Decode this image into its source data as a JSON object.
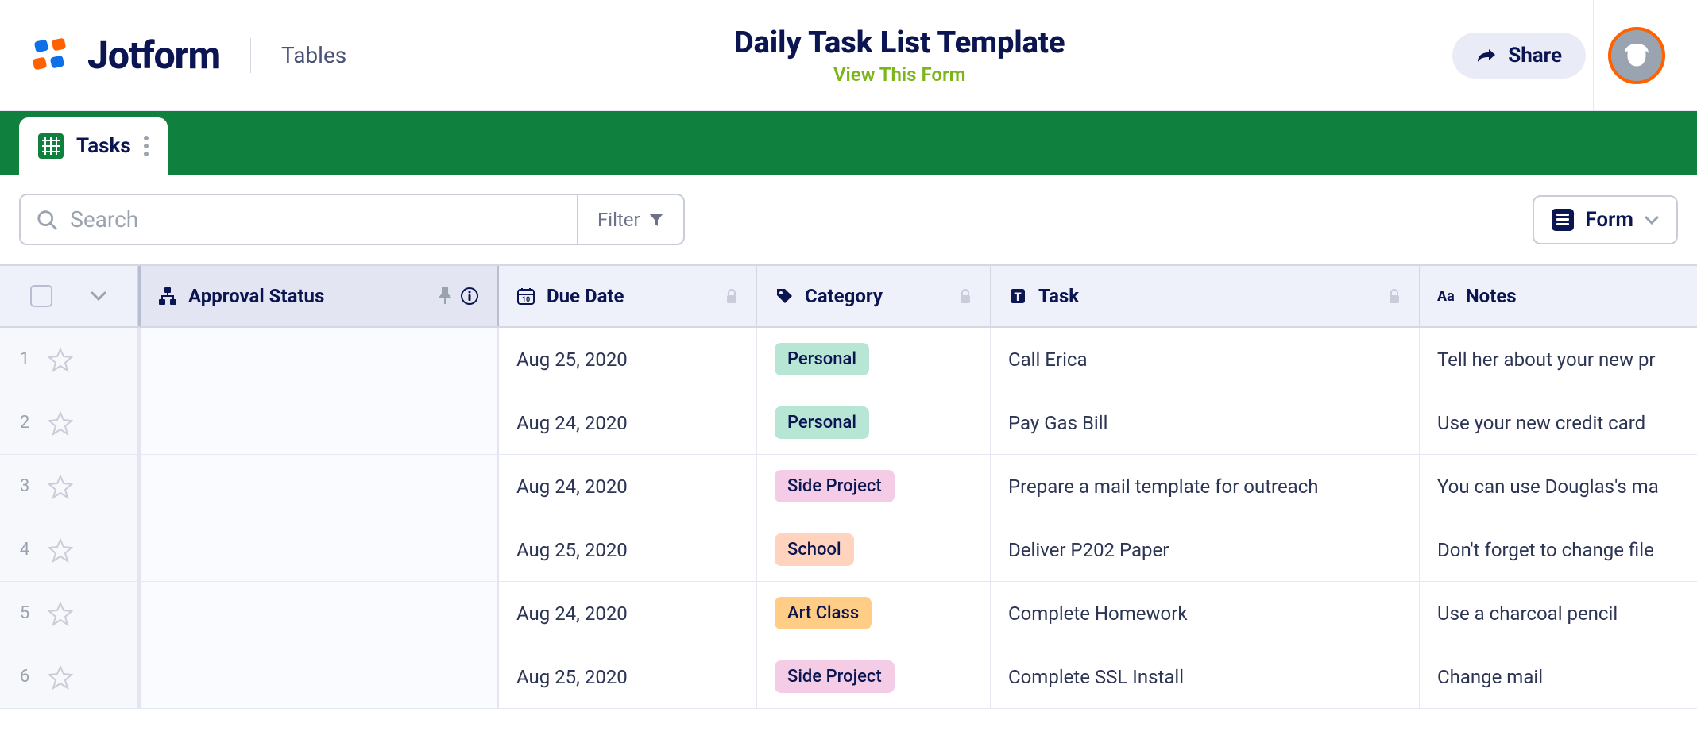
{
  "header": {
    "brand": "Jotform",
    "product": "Tables",
    "title": "Daily Task List Template",
    "subtitle": "View This Form",
    "share": "Share"
  },
  "tab": {
    "label": "Tasks"
  },
  "toolbar": {
    "search_placeholder": "Search",
    "filter": "Filter",
    "form": "Form"
  },
  "columns": {
    "approval": "Approval Status",
    "due_date": "Due Date",
    "category": "Category",
    "task": "Task",
    "notes": "Notes"
  },
  "category_colors": {
    "Personal": "#b8e6d5",
    "Side Project": "#f5cce5",
    "School": "#ffd3bd",
    "Art Class": "#ffcd85"
  },
  "rows": [
    {
      "num": "1",
      "due": "Aug 25, 2020",
      "cat": "Personal",
      "task": "Call Erica",
      "notes": "Tell her about your new pr"
    },
    {
      "num": "2",
      "due": "Aug 24, 2020",
      "cat": "Personal",
      "task": "Pay Gas Bill",
      "notes": "Use your new credit card"
    },
    {
      "num": "3",
      "due": "Aug 24, 2020",
      "cat": "Side Project",
      "task": "Prepare a mail template for outreach",
      "notes": "You can use Douglas's ma"
    },
    {
      "num": "4",
      "due": "Aug 25, 2020",
      "cat": "School",
      "task": "Deliver P202 Paper",
      "notes": "Don't forget to change file"
    },
    {
      "num": "5",
      "due": "Aug 24, 2020",
      "cat": "Art Class",
      "task": "Complete Homework",
      "notes": "Use a charcoal pencil"
    },
    {
      "num": "6",
      "due": "Aug 25, 2020",
      "cat": "Side Project",
      "task": "Complete SSL Install",
      "notes": "Change mail"
    }
  ]
}
